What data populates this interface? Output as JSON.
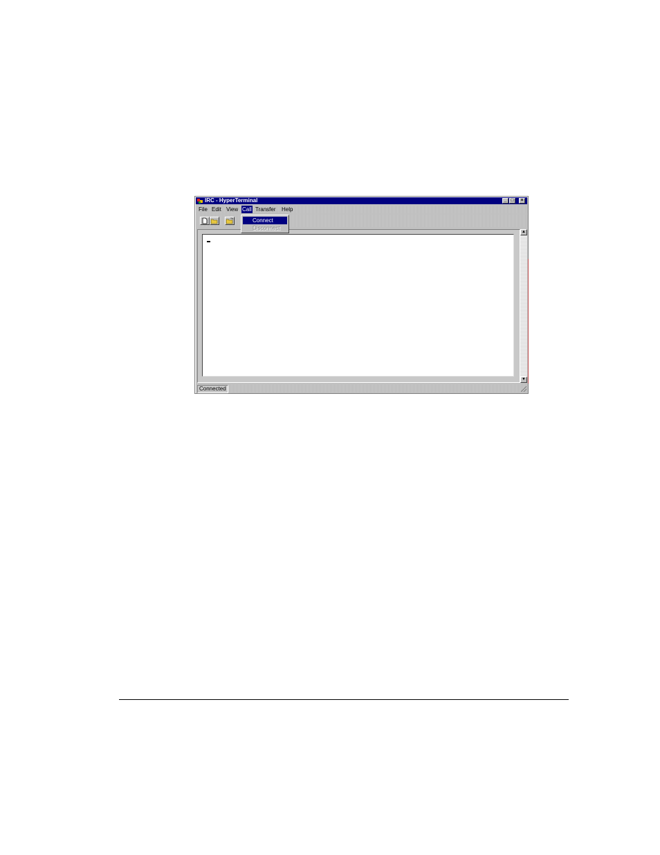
{
  "window": {
    "title": "IRC - HyperTerminal"
  },
  "menubar": {
    "items": [
      {
        "label": "File"
      },
      {
        "label": "Edit"
      },
      {
        "label": "View"
      },
      {
        "label": "Call"
      },
      {
        "label": "Transfer"
      },
      {
        "label": "Help"
      }
    ],
    "active_item": "Call"
  },
  "call_menu": {
    "items": [
      {
        "label": "Connect",
        "state": "highlighted"
      },
      {
        "label": "Disconnect",
        "state": "disabled"
      }
    ]
  },
  "statusbar": {
    "status": "Connected"
  },
  "colors": {
    "titlebar": "#000080",
    "face": "#c0c0c0",
    "highlight": "#000080"
  }
}
